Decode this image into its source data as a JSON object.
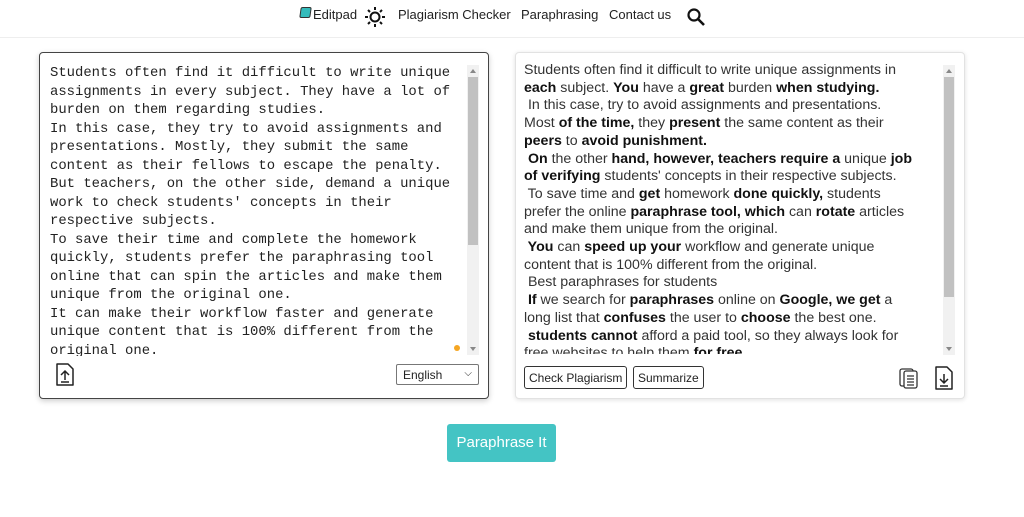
{
  "nav": {
    "brand": "Editpad",
    "items": [
      "Plagiarism Checker",
      "Paraphrasing",
      "Contact us"
    ],
    "icons": [
      "book-icon",
      "sun-icon",
      "search-icon"
    ]
  },
  "input": {
    "text": "Students often find it difficult to write unique\nassignments in every subject. They have a lot of\nburden on them regarding studies.\nIn this case, they try to avoid assignments and\npresentations. Mostly, they submit the same\ncontent as their fellows to escape the penalty.\nBut teachers, on the other side, demand a unique\nwork to check students' concepts in their\nrespective subjects.\nTo save their time and complete the homework\nquickly, students prefer the paraphrasing tool\nonline that can spin the articles and make them\nunique from the original one.\nIt can make their workflow faster and generate\nunique content that is 100% different from the\noriginal one.",
    "language": "English"
  },
  "output": {
    "lines": [
      [
        {
          "t": "Students often find it difficult to write unique assignments in",
          "b": false
        }
      ],
      [
        {
          "t": "each",
          "b": true
        },
        {
          "t": " subject. ",
          "b": false
        },
        {
          "t": "You",
          "b": true
        },
        {
          "t": " have a ",
          "b": false
        },
        {
          "t": "great",
          "b": true
        },
        {
          "t": " burden ",
          "b": false
        },
        {
          "t": "when studying.",
          "b": true
        }
      ],
      [
        {
          "t": " In this case, try to avoid assignments and presentations.",
          "b": false
        }
      ],
      [
        {
          "t": "Most ",
          "b": false
        },
        {
          "t": "of the time,",
          "b": true
        },
        {
          "t": " they ",
          "b": false
        },
        {
          "t": "present",
          "b": true
        },
        {
          "t": " the same content as their",
          "b": false
        }
      ],
      [
        {
          "t": "peers",
          "b": true
        },
        {
          "t": " to ",
          "b": false
        },
        {
          "t": "avoid punishment.",
          "b": true
        }
      ],
      [
        {
          "t": " On",
          "b": true
        },
        {
          "t": " the other ",
          "b": false
        },
        {
          "t": "hand, however, teachers require a",
          "b": true
        },
        {
          "t": " unique ",
          "b": false
        },
        {
          "t": "job",
          "b": true
        }
      ],
      [
        {
          "t": "of verifying",
          "b": true
        },
        {
          "t": " students' concepts in their respective subjects.",
          "b": false
        }
      ],
      [
        {
          "t": " To save time and ",
          "b": false
        },
        {
          "t": "get",
          "b": true
        },
        {
          "t": " homework ",
          "b": false
        },
        {
          "t": "done quickly,",
          "b": true
        },
        {
          "t": " students",
          "b": false
        }
      ],
      [
        {
          "t": "prefer the online ",
          "b": false
        },
        {
          "t": "paraphrase tool, which",
          "b": true
        },
        {
          "t": " can ",
          "b": false
        },
        {
          "t": "rotate",
          "b": true
        },
        {
          "t": " articles",
          "b": false
        }
      ],
      [
        {
          "t": "and make them unique from the original.",
          "b": false
        }
      ],
      [
        {
          "t": " You",
          "b": true
        },
        {
          "t": " can ",
          "b": false
        },
        {
          "t": "speed up your",
          "b": true
        },
        {
          "t": " workflow and generate unique",
          "b": false
        }
      ],
      [
        {
          "t": "content that is 100% different from the original.",
          "b": false
        }
      ],
      [
        {
          "t": " Best paraphrases for students",
          "b": false
        }
      ],
      [
        {
          "t": " If",
          "b": true
        },
        {
          "t": " we search for ",
          "b": false
        },
        {
          "t": "paraphrases",
          "b": true
        },
        {
          "t": " online on ",
          "b": false
        },
        {
          "t": "Google, we get",
          "b": true
        },
        {
          "t": " a",
          "b": false
        }
      ],
      [
        {
          "t": "long list that ",
          "b": false
        },
        {
          "t": "confuses",
          "b": true
        },
        {
          "t": " the user to ",
          "b": false
        },
        {
          "t": "choose",
          "b": true
        },
        {
          "t": " the best one.",
          "b": false
        }
      ],
      [
        {
          "t": " students cannot",
          "b": true
        },
        {
          "t": " afford a paid tool, so they always look for",
          "b": false
        }
      ],
      [
        {
          "t": "free websites to help them ",
          "b": false
        },
        {
          "t": "for free.",
          "b": true
        }
      ]
    ],
    "buttons": {
      "check": "Check Plagiarism",
      "summarize": "Summarize"
    }
  },
  "action": {
    "paraphrase": "Paraphrase It"
  },
  "colors": {
    "accent": "#44c4c4",
    "dot": "#f5a623"
  }
}
